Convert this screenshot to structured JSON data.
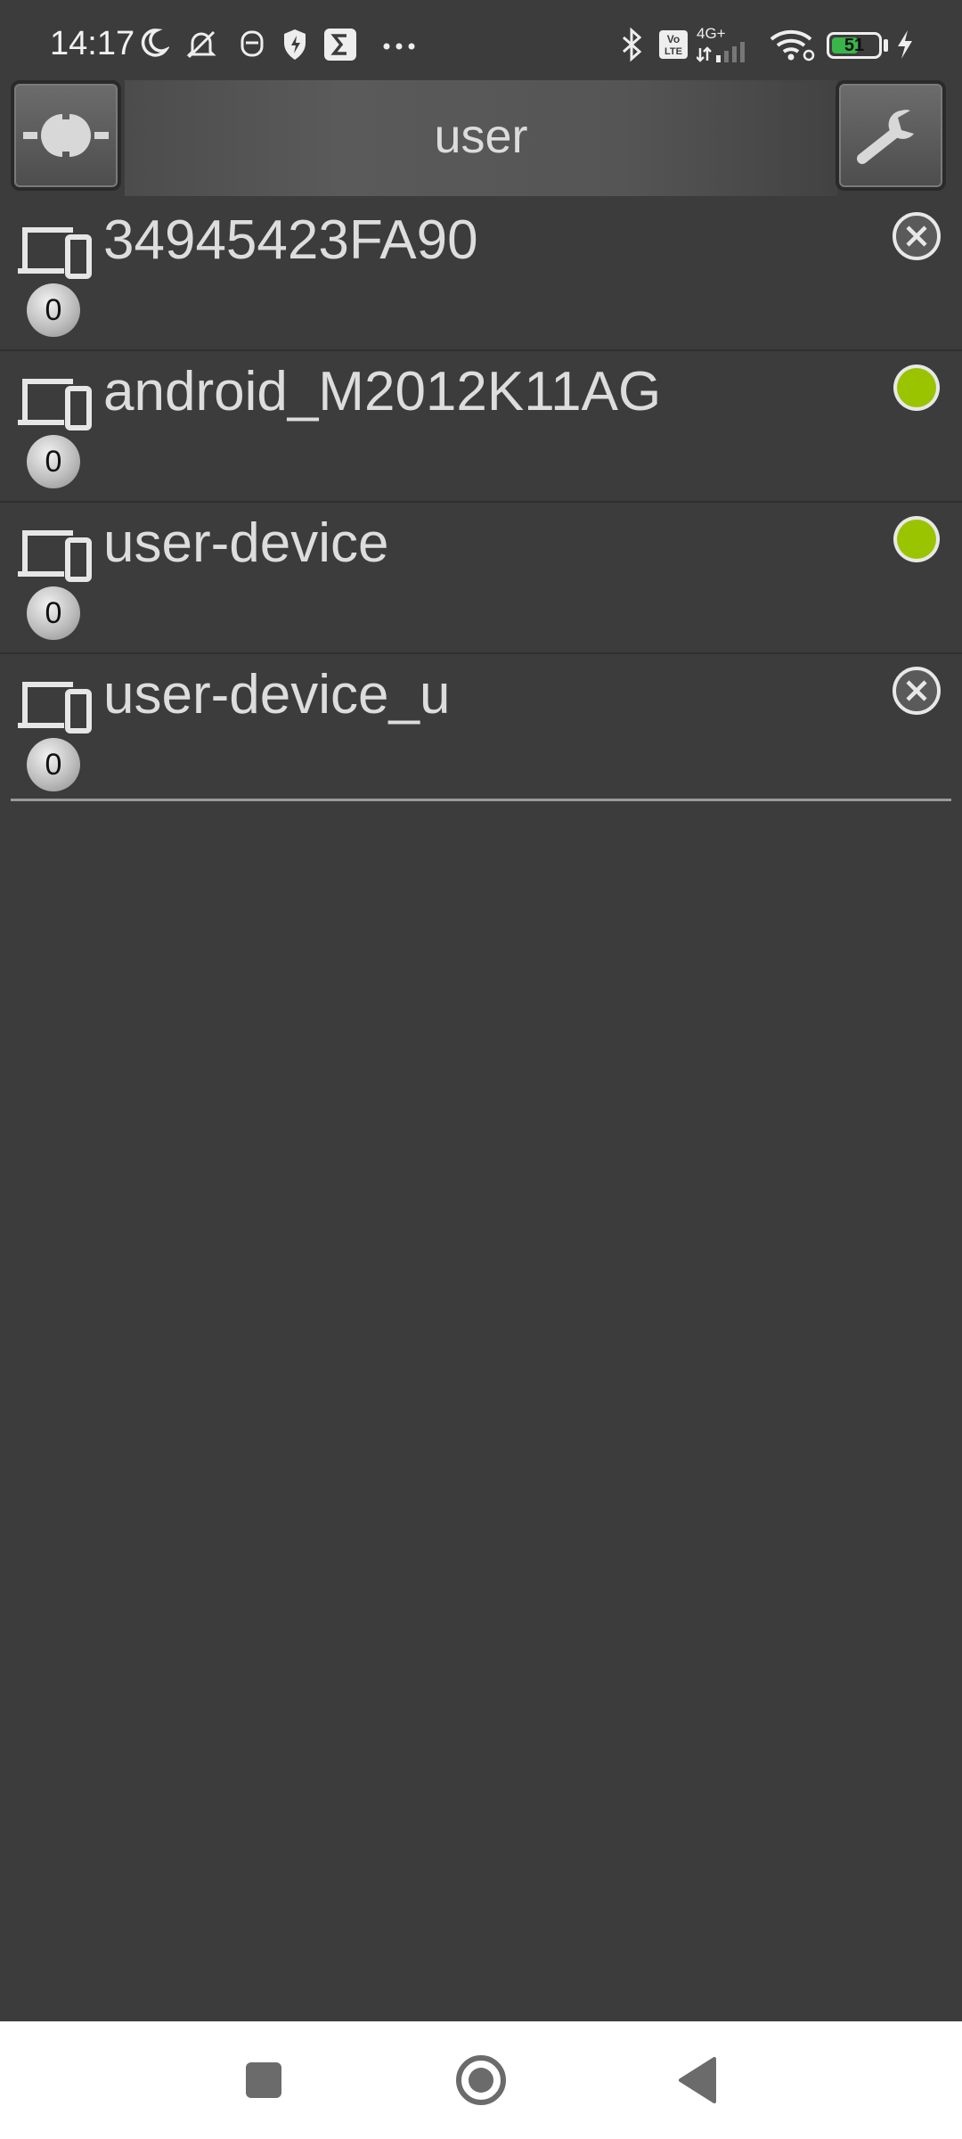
{
  "status_bar": {
    "time": "14:17",
    "network": "4G+",
    "battery_level": "51",
    "battery_percent": 51,
    "icons": [
      "moon-icon",
      "silent-icon",
      "face-icon",
      "shield-icon",
      "sigma-icon",
      "more-dots-icon",
      "bluetooth-icon",
      "volte-icon",
      "signal-icon",
      "wifi-icon",
      "battery-icon",
      "charging-icon"
    ]
  },
  "app_bar": {
    "title": "user",
    "left_button": "plug-icon",
    "right_button": "wrench-icon"
  },
  "devices": [
    {
      "name": "34945423FA90",
      "count": "0",
      "status": "offline",
      "status_icon": "close-circle-icon"
    },
    {
      "name": "android_M2012K11AG",
      "count": "0",
      "status": "online",
      "status_icon": "green-dot-icon"
    },
    {
      "name": "user-device",
      "count": "0",
      "status": "online",
      "status_icon": "green-dot-icon"
    },
    {
      "name": "user-device_u",
      "count": "0",
      "status": "offline",
      "status_icon": "close-circle-icon"
    }
  ],
  "colors": {
    "background": "#3c3c3c",
    "online": "#9bc400",
    "text": "#dddddd"
  },
  "nav_bar": {
    "items": [
      "recents-square-icon",
      "home-circle-icon",
      "back-triangle-icon"
    ]
  }
}
